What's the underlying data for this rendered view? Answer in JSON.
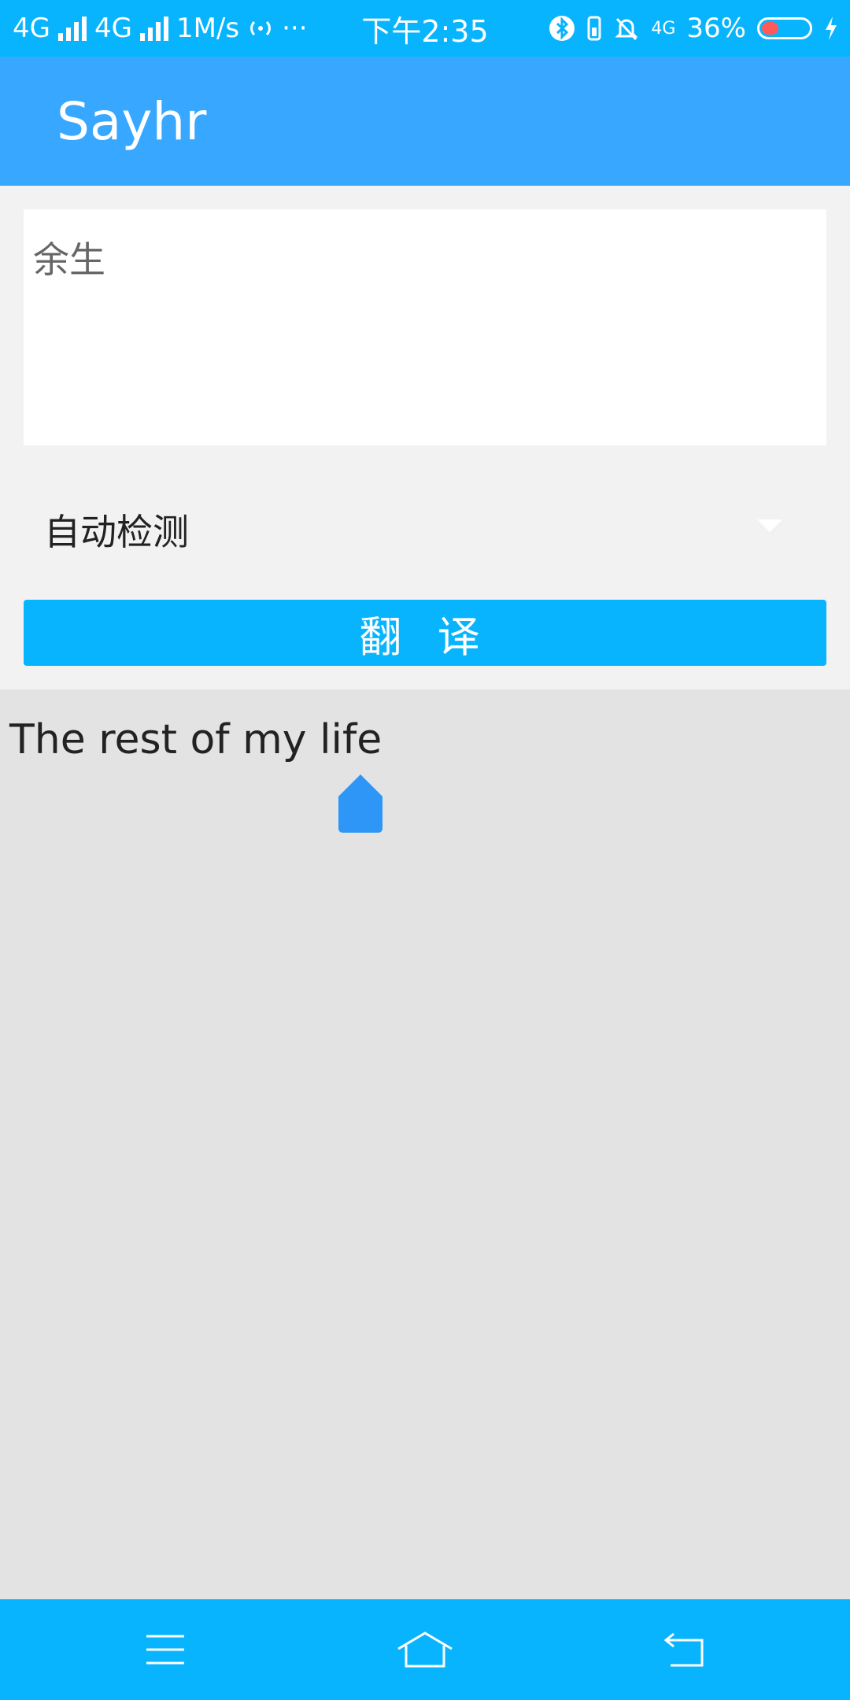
{
  "status_bar": {
    "network1": "4G",
    "network2": "4G",
    "speed": "1M/s",
    "more": "···",
    "time": "下午2:35",
    "network3": "4G",
    "battery_pct": "36%",
    "battery_level": 0.36
  },
  "app_bar": {
    "title": "Sayhr"
  },
  "input": {
    "value": "余生"
  },
  "language": {
    "selected": "自动检测"
  },
  "translate_button": {
    "label": "翻 译"
  },
  "result": {
    "text": "The rest of my life"
  },
  "colors": {
    "status": "#07b4fd",
    "app_bar": "#37a7ff",
    "button": "#07b4fd",
    "handle": "#2d96f6"
  },
  "nav_icons": [
    "menu-icon",
    "home-icon",
    "back-icon"
  ]
}
